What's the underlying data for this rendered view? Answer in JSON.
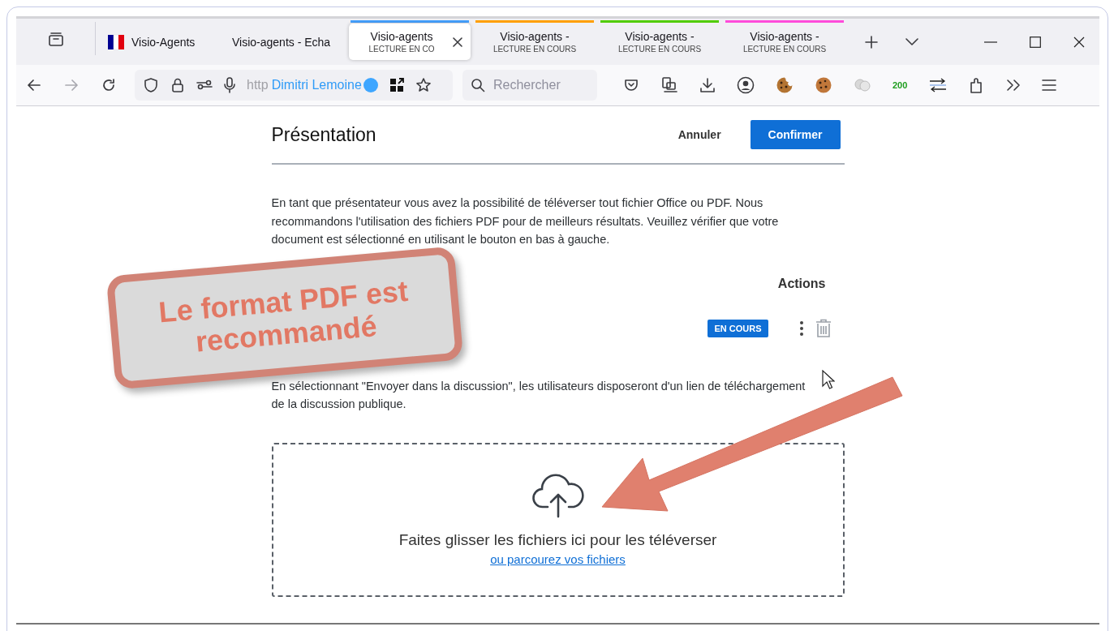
{
  "tabs": [
    {
      "kind": "favicon",
      "title": "Visio-Agents",
      "selected": false
    },
    {
      "kind": "plain",
      "title": "Visio-agents - Echa",
      "selected": false
    },
    {
      "kind": "plain",
      "title": "Visio-agents",
      "subtitle": "LECTURE EN CO",
      "selected": true,
      "color": "#45a1ff"
    },
    {
      "kind": "plain",
      "title": "Visio-agents -",
      "subtitle": "LECTURE EN COURS",
      "selected": false,
      "color": "#ff9f00"
    },
    {
      "kind": "plain",
      "title": "Visio-agents -",
      "subtitle": "LECTURE EN COURS",
      "selected": false,
      "color": "#51cd00"
    },
    {
      "kind": "plain",
      "title": "Visio-agents -",
      "subtitle": "LECTURE EN COURS",
      "selected": false,
      "color": "#ff4bda"
    }
  ],
  "nav_buttons": [
    {
      "kind": "back",
      "disabled": false
    },
    {
      "kind": "forward",
      "disabled": true
    },
    {
      "kind": "reload",
      "disabled": false
    }
  ],
  "url_bar": {
    "scheme": "http",
    "identity": "Dimitri Lemoine"
  },
  "search": {
    "placeholder": "Rechercher"
  },
  "toolbar_counter": "200",
  "dialog": {
    "title": "Présentation",
    "cancel": "Annuler",
    "confirm": "Confirmer",
    "intro": "En tant que présentateur vous avez la possibilité de téléverser tout fichier Office ou PDF. Nous recommandons l'utilisation des fichiers PDF pour de meilleurs résultats. Veuillez vérifier que votre document est sélectionné en utilisant le bouton en bas à gauche.",
    "table": {
      "columns": [
        "Actions"
      ],
      "rows": [
        {
          "status": "EN COURS"
        }
      ]
    },
    "chat_note": "En sélectionnant \"Envoyer dans la discussion\", les utilisateurs disposeront d'un lien de téléchargement de la discussion publique.",
    "dropzone": {
      "text": "Faites glisser les fichiers ici pour les téléverser",
      "link": "ou parcourez vos fichiers"
    }
  },
  "annotation": {
    "callout": "Le format PDF est recommandé"
  }
}
